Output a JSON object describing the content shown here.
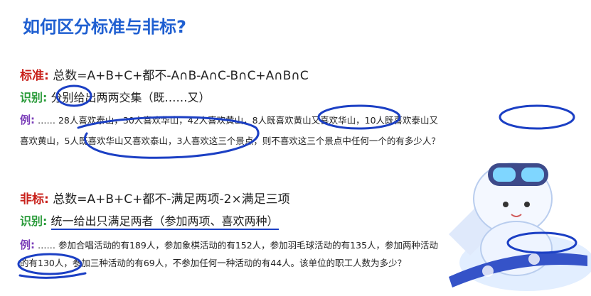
{
  "title": "如何区分标准与非标?",
  "standard": {
    "label": "标准:",
    "formula": "总数=A+B+C+都不-A∩B-A∩C-B∩C+A∩B∩C",
    "identify_label": "识别:",
    "identify_text": "分别给出两两交集（既……又）",
    "example_label": "例:",
    "example_line1": "…… 28人喜欢泰山，30人喜欢华山，42人喜欢黄山，8人既喜欢黄山又喜欢华山，10人既喜欢泰山又",
    "example_line2": "喜欢黄山，5人既喜欢华山又喜欢泰山，3人喜欢这三个景点，则不喜欢这三个景点中任何一个的有多少人？"
  },
  "nonstandard": {
    "label": "非标:",
    "formula": "总数=A+B+C+都不-满足两项-2×满足三项",
    "identify_label": "识别:",
    "identify_text": "统一给出只满足两者（参加两项、喜欢两种）",
    "example_label": "例:",
    "example_line1": "…… 参加合唱活动的有189人，参加象棋活动的有152人，参加羽毛球活动的有135人，参加两种活动",
    "example_line2": "的有130人，参加三种活动的有69人，不参加任何一种活动的有44人。该单位的职工人数为多少？"
  },
  "colors": {
    "title": "#1f5fd1",
    "label_red": "#c8201a",
    "label_green": "#2a9b3a",
    "label_purple": "#7a3db8",
    "annotation": "#1b3fc4"
  },
  "mascot_icon": "snowboard-mascot-icon"
}
